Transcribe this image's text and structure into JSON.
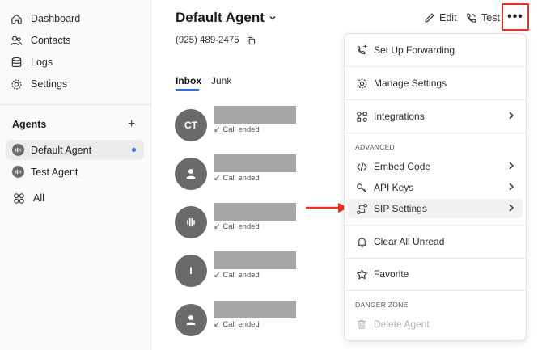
{
  "sidebar": {
    "nav": [
      {
        "label": "Dashboard",
        "icon": "home-icon"
      },
      {
        "label": "Contacts",
        "icon": "contacts-icon"
      },
      {
        "label": "Logs",
        "icon": "database-icon"
      },
      {
        "label": "Settings",
        "icon": "gear-icon"
      }
    ],
    "agents_title": "Agents",
    "agents_add": "+",
    "agents": [
      {
        "label": "Default Agent",
        "active": true
      },
      {
        "label": "Test Agent",
        "active": false
      }
    ],
    "all_label": "All"
  },
  "header": {
    "agent_name": "Default Agent",
    "phone": "(925) 489-2475",
    "edit_label": "Edit",
    "test_label": "Test",
    "more_label": "•••"
  },
  "tabs": [
    {
      "label": "Inbox",
      "active": true
    },
    {
      "label": "Junk",
      "active": false
    }
  ],
  "conversations": [
    {
      "avatar": "CT",
      "status": "Call ended"
    },
    {
      "avatar": "user-icon",
      "status": "Call ended"
    },
    {
      "avatar": "waveform-icon",
      "status": "Call ended"
    },
    {
      "avatar": "I",
      "status": "Call ended"
    },
    {
      "avatar": "user-icon",
      "status": "Call ended"
    }
  ],
  "menu": {
    "set_up_forwarding": "Set Up Forwarding",
    "manage_settings": "Manage Settings",
    "integrations": "Integrations",
    "advanced_section": "ADVANCED",
    "embed_code": "Embed Code",
    "api_keys": "API Keys",
    "sip_settings": "SIP Settings",
    "clear_all_unread": "Clear All Unread",
    "favorite": "Favorite",
    "danger_section": "DANGER ZONE",
    "delete_agent": "Delete Agent"
  },
  "colors": {
    "accent": "#2f6fe4",
    "highlight_box": "#e53222",
    "annotation_arrow": "#e53222",
    "placeholder_bar": "#a6a6a6",
    "avatar": "#6a6a6a"
  }
}
